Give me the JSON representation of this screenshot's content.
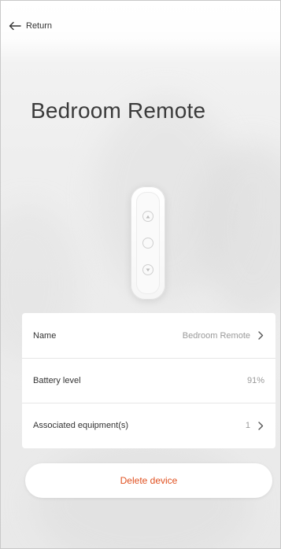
{
  "header": {
    "return_label": "Return"
  },
  "device": {
    "title": "Bedroom Remote"
  },
  "details": [
    {
      "label": "Name",
      "value": "Bedroom Remote",
      "has_chevron": true
    },
    {
      "label": "Battery level",
      "value": "91%",
      "has_chevron": false
    },
    {
      "label": "Associated equipment(s)",
      "value": "1",
      "has_chevron": true
    }
  ],
  "actions": {
    "delete_label": "Delete device"
  },
  "colors": {
    "accent_danger": "#e0501f",
    "text_primary": "#333333",
    "text_secondary": "#9a9a9a"
  },
  "icons": {
    "back": "arrow-left-icon",
    "chevron": "chevron-right-icon",
    "remote_up": "arrow-up-circle-icon",
    "remote_stop": "circle-icon",
    "remote_down": "arrow-down-circle-icon"
  }
}
